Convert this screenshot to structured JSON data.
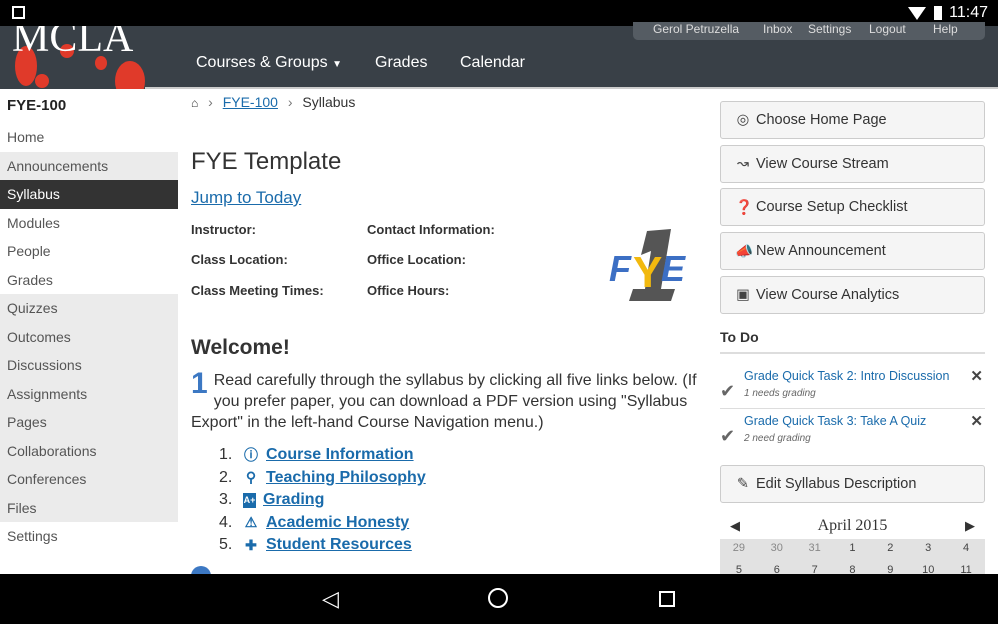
{
  "status_bar": {
    "time": "11:47"
  },
  "header": {
    "logo": "MCLA",
    "nav": [
      "Courses & Groups",
      "Grades",
      "Calendar"
    ],
    "user_nav": [
      "Gerol Petruzella",
      "Inbox",
      "Settings",
      "Logout",
      "Help"
    ]
  },
  "sidebar": {
    "course": "FYE-100",
    "active": "Syllabus",
    "items": [
      {
        "label": "Home",
        "style": "white"
      },
      {
        "label": "Announcements",
        "style": "grey"
      },
      {
        "label": "Syllabus",
        "style": "active"
      },
      {
        "label": "Modules",
        "style": "white"
      },
      {
        "label": "People",
        "style": "white"
      },
      {
        "label": "Grades",
        "style": "white"
      },
      {
        "label": "Quizzes",
        "style": "grey"
      },
      {
        "label": "Outcomes",
        "style": "grey"
      },
      {
        "label": "Discussions",
        "style": "grey"
      },
      {
        "label": "Assignments",
        "style": "grey"
      },
      {
        "label": "Pages",
        "style": "grey"
      },
      {
        "label": "Collaborations",
        "style": "grey"
      },
      {
        "label": "Conferences",
        "style": "grey"
      },
      {
        "label": "Files",
        "style": "grey"
      },
      {
        "label": "Settings",
        "style": "white"
      }
    ]
  },
  "breadcrumb": {
    "course": "FYE-100",
    "page": "Syllabus"
  },
  "main": {
    "title": "FYE Template",
    "jump": "Jump to Today",
    "info": {
      "instructor": "Instructor:",
      "contact": "Contact Information:",
      "class_location": "Class Location:",
      "office_location": "Office Location:",
      "meeting_times": "Class Meeting Times:",
      "office_hours": "Office Hours:"
    },
    "logo_text": "FYE",
    "welcome": "Welcome!",
    "step1_number": "1",
    "step1_text": "Read carefully through the syllabus by clicking all five links below. (If you prefer paper, you can download a PDF version using \"Syllabus Export\" in the left-hand Course Navigation menu.)",
    "links": [
      {
        "num": "1.",
        "icon": "info-icon",
        "label": "Course Information"
      },
      {
        "num": "2.",
        "icon": "search-icon",
        "label": "Teaching Philosophy"
      },
      {
        "num": "3.",
        "icon": "grade-icon",
        "label": "Grading"
      },
      {
        "num": "4.",
        "icon": "warning-icon",
        "label": "Academic Honesty"
      },
      {
        "num": "5.",
        "icon": "user-plus-icon",
        "label": "Student Resources"
      }
    ]
  },
  "right": {
    "buttons": [
      "Choose Home Page",
      "View Course Stream",
      "Course Setup Checklist",
      "New Announcement",
      "View Course Analytics"
    ],
    "todo_title": "To Do",
    "todos": [
      {
        "title": "Grade Quick Task 2: Intro Discussion",
        "sub": "1 needs grading"
      },
      {
        "title": "Grade Quick Task 3: Take A Quiz",
        "sub": "2 need grading"
      }
    ],
    "edit_button": "Edit Syllabus Description",
    "calendar": {
      "month": "April 2015",
      "days": [
        "29",
        "30",
        "31",
        "1",
        "2",
        "3",
        "4",
        "5",
        "6",
        "7",
        "8",
        "9",
        "10",
        "11"
      ]
    }
  },
  "colors": {
    "header": "#394047",
    "link": "#1a6bab",
    "logo_red": "#e03a2a"
  }
}
